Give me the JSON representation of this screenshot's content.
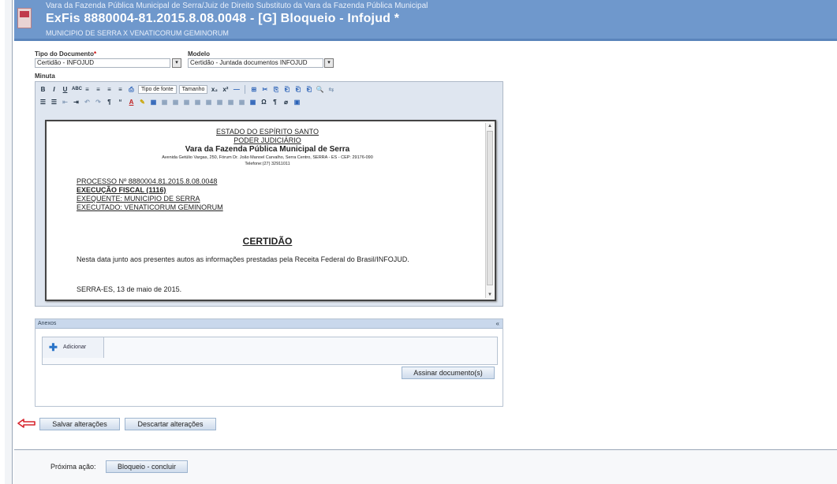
{
  "header": {
    "court": "Vara da Fazenda Pública Municipal de Serra/Juiz de Direito Substituto da Vara da Fazenda Pública Municipal",
    "title": "ExFis 8880004-81.2015.8.08.0048 - [G] Bloqueio - Infojud *",
    "parties": "MUNICIPIO DE SERRA X VENATICORUM GEMINORUM"
  },
  "form": {
    "tipo_label": "Tipo do Documento",
    "tipo_required": "*",
    "tipo_value": "Certidão - INFOJUD",
    "modelo_label": "Modelo",
    "modelo_value": "Certidão - Juntada documentos INFOJUD",
    "minuta_label": "Minuta"
  },
  "toolbar": {
    "row1": [
      "B",
      "I",
      "U",
      "ABC",
      "≡",
      "≡",
      "≡",
      "≡",
      "⎙"
    ],
    "font_select": "Tipo de fonte",
    "size_select": "Tamanho",
    "row1b": [
      "x₂",
      "x²",
      "—",
      "⊞",
      "✂",
      "⎘",
      "⎗",
      "⎗",
      "⎗",
      "🔍",
      "⇆"
    ],
    "row2": [
      "☰",
      "☰",
      "⇤",
      "⇥",
      "↶",
      "↷",
      "¶",
      "“",
      "A",
      "✎",
      "▦",
      "▦",
      "▦",
      "▦",
      "▦",
      "▦",
      "▦",
      "▦",
      "▦",
      "▦",
      "Ω",
      "¶",
      "⌀",
      "▣"
    ]
  },
  "document": {
    "state": "ESTADO DO ESPÍRITO SANTO",
    "power": "PODER JUDICIÁRIO",
    "court": "Vara da Fazenda Pública Municipal de Serra",
    "address": "Avenida Getúlio Vargas, 250, Fórum Dr. João Manoel Carvalho, Serra Centro, SERRA - ES - CEP: 29176-090",
    "phone": "Telefone:(27) 32911011",
    "processo": "PROCESSO Nº 8880004.81.2015.8.08.0048",
    "execucao": "EXECUÇÃO FISCAL (1116)",
    "exequente": "EXEQUENTE: MUNICIPIO DE SERRA",
    "executado": "EXECUTADO: VENATICORUM GEMINORUM",
    "heading": "CERTIDÃO",
    "body": "Nesta data junto aos presentes autos as informações prestadas pela Receita Federal do Brasil/INFOJUD.",
    "place_date": "SERRA-ES, 13 de maio de 2015."
  },
  "anexos": {
    "title": "Anexos",
    "close": "«",
    "add_label": "Adicionar",
    "sign_button": "Assinar documento(s)"
  },
  "actions": {
    "save": "Salvar alterações",
    "discard": "Descartar alterações"
  },
  "footer": {
    "next_label": "Próxima ação:",
    "next_button": "Bloqueio - concluir"
  },
  "colors": {
    "header_bg": "#6f98cc",
    "arrow": "#d7262f"
  }
}
